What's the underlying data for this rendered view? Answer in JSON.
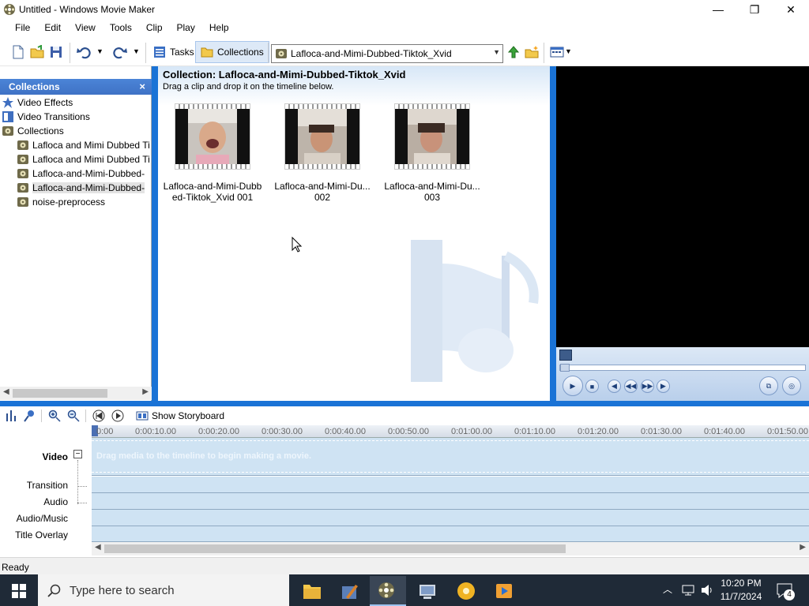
{
  "window": {
    "title": "Untitled - Windows Movie Maker",
    "minimize": "—",
    "restore": "❐",
    "close": "✕"
  },
  "menu": [
    "File",
    "Edit",
    "View",
    "Tools",
    "Clip",
    "Play",
    "Help"
  ],
  "toolbar": {
    "tasks_label": "Tasks",
    "collections_label": "Collections",
    "collection_select_value": "Lafloca-and-Mimi-Dubbed-Tiktok_Xvid"
  },
  "collections_panel": {
    "header": "Collections",
    "close": "×",
    "items": [
      {
        "label": "Video Effects",
        "icon": "star-icon",
        "level": 0
      },
      {
        "label": "Video Transitions",
        "icon": "transition-icon",
        "level": 0
      },
      {
        "label": "Collections",
        "icon": "film-reel-icon",
        "level": 0
      },
      {
        "label": "Lafloca and Mimi Dubbed Ti",
        "icon": "film-reel-icon",
        "level": 1
      },
      {
        "label": "Lafloca and Mimi Dubbed Ti",
        "icon": "film-reel-icon",
        "level": 1
      },
      {
        "label": "Lafloca-and-Mimi-Dubbed-",
        "icon": "film-reel-icon",
        "level": 1
      },
      {
        "label": "Lafloca-and-Mimi-Dubbed-",
        "icon": "film-reel-icon",
        "level": 1,
        "selected": true
      },
      {
        "label": "noise-preprocess",
        "icon": "film-reel-icon",
        "level": 1
      }
    ]
  },
  "content": {
    "title": "Collection: Lafloca-and-Mimi-Dubbed-Tiktok_Xvid",
    "hint": "Drag a clip and drop it on the timeline below.",
    "clips": [
      {
        "line1": "Lafloca-and-Mimi-Dubb",
        "line2": "ed-Tiktok_Xvid 001"
      },
      {
        "line1": "Lafloca-and-Mimi-Du...",
        "line2": "002"
      },
      {
        "line1": "Lafloca-and-Mimi-Du...",
        "line2": "003"
      }
    ]
  },
  "timeline": {
    "show_storyboard": "Show Storyboard",
    "ruler_ticks": [
      "0:00",
      "0:00:10.00",
      "0:00:20.00",
      "0:00:30.00",
      "0:00:40.00",
      "0:00:50.00",
      "0:01:00.00",
      "0:01:10.00",
      "0:01:20.00",
      "0:01:30.00",
      "0:01:40.00",
      "0:01:50.00"
    ],
    "tracks": {
      "video": "Video",
      "transition": "Transition",
      "audio": "Audio",
      "audio_music": "Audio/Music",
      "title_overlay": "Title Overlay"
    },
    "video_hint": "Drag media to the timeline to begin making a movie.",
    "collapse": "−"
  },
  "status": {
    "text": "Ready"
  },
  "taskbar": {
    "search_placeholder": "Type here to search",
    "time": "10:20 PM",
    "date": "11/7/2024",
    "notifications": "4"
  },
  "colors": {
    "accent": "#1a73d6",
    "panel_header": "#3f72c5",
    "track": "#cfe3f3"
  }
}
